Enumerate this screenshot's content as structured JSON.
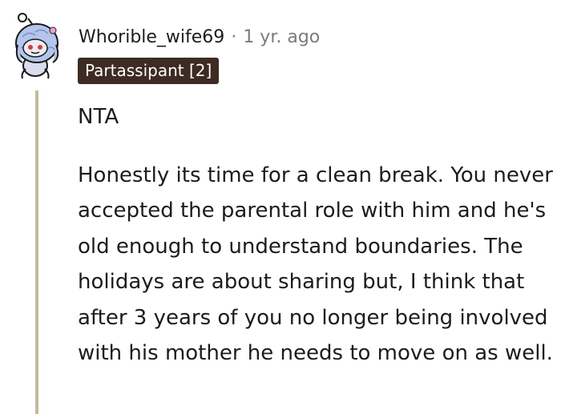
{
  "comment": {
    "author": "Whorible_wife69",
    "separator": "·",
    "age": "1 yr. ago",
    "flair": "Partassipant [2]",
    "paragraphs": [
      "NTA",
      "Honestly its time for a clean break. You never accepted the parental role with him and he's old enough to understand boundaries. The holidays are about sharing but, I think that after 3 years of you no longer being involved with his mother he needs to move on as well."
    ]
  },
  "colors": {
    "flair_bg": "#3e2b23",
    "thread_line": "#c6b89b",
    "meta_text": "#787c7e",
    "body_text": "#1c1c1c",
    "avatar_bg": "#c9d6f2"
  },
  "icons": {
    "avatar": "snoo-avatar-icon"
  }
}
